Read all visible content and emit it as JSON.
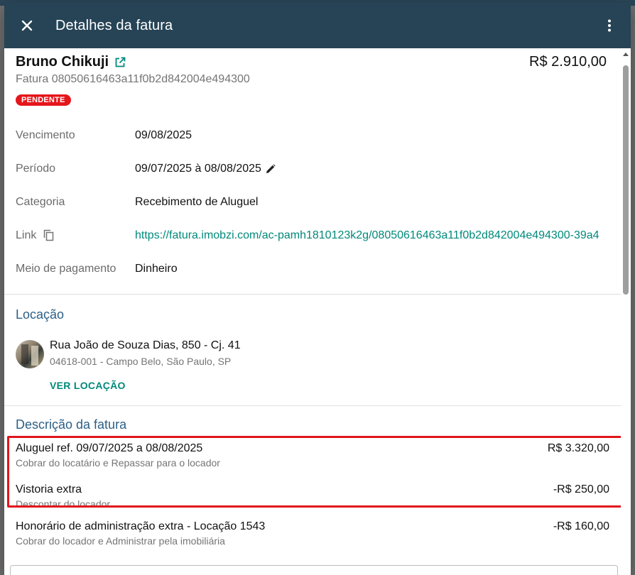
{
  "header": {
    "title": "Detalhes da fatura",
    "close_icon": "close-icon",
    "more_icon": "more-vert-icon",
    "bg_color": "#264456"
  },
  "invoice": {
    "client_name": "Bruno Chikuji",
    "total": "R$ 2.910,00",
    "id_line": "Fatura 08050616463a11f0b2d842004e494300",
    "status": "PENDENTE",
    "status_color": "#e5161b"
  },
  "details": {
    "due_label": "Vencimento",
    "due_value": "09/08/2025",
    "period_label": "Período",
    "period_value": "09/07/2025 à 08/08/2025",
    "category_label": "Categoria",
    "category_value": "Recebimento de Aluguel",
    "link_label": "Link",
    "link_value": "https://fatura.imobzi.com/ac-pamh1810123k2g/08050616463a11f0b2d842004e494300-39a4",
    "payment_label": "Meio de pagamento",
    "payment_value": "Dinheiro"
  },
  "location": {
    "title": "Locação",
    "address": "Rua João de Souza Dias, 850 - Cj. 41",
    "subaddress": "04618-001 - Campo Belo, São Paulo, SP",
    "action": "VER LOCAÇÃO"
  },
  "description": {
    "title": "Descrição da fatura",
    "items": [
      {
        "label": "Aluguel ref. 09/07/2025 a 08/08/2025",
        "value": "R$ 3.320,00",
        "note": "Cobrar do locatário e Repassar para o locador"
      },
      {
        "label": "Vistoria extra",
        "value": "-R$ 250,00",
        "note": "Descontar do locador"
      },
      {
        "label": "Honorário de administração extra - Locação 1543",
        "value": "-R$ 160,00",
        "note": "Cobrar do locador e Administrar pela imobiliária"
      }
    ]
  },
  "colors": {
    "accent_teal": "#00897b",
    "section_blue": "#2c5f86",
    "highlight_red": "#e0161b"
  }
}
